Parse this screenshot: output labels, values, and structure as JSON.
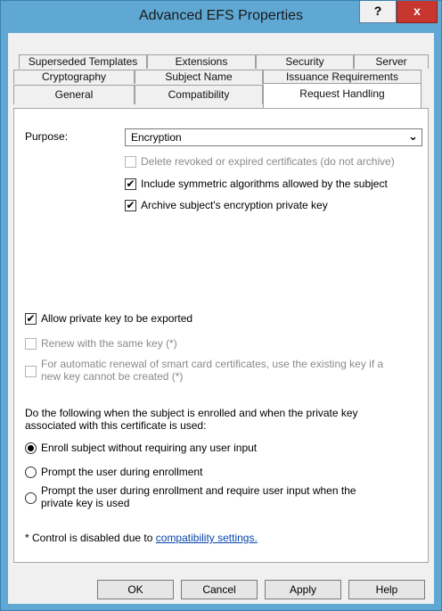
{
  "window": {
    "title": "Advanced EFS Properties",
    "help_glyph": "?",
    "close_glyph": "x"
  },
  "tabs": {
    "row1": [
      "Superseded Templates",
      "Extensions",
      "Security",
      "Server"
    ],
    "row2": [
      "Cryptography",
      "Subject Name",
      "Issuance Requirements"
    ],
    "row3": [
      "General",
      "Compatibility",
      "Request Handling"
    ],
    "active": "Request Handling"
  },
  "purpose": {
    "label": "Purpose:",
    "value": "Encryption",
    "dropdown_glyph": "⌄"
  },
  "options": {
    "delete_revoked": {
      "label": "Delete revoked or expired certificates (do not archive)",
      "checked": false,
      "enabled": false
    },
    "include_symmetric": {
      "label": "Include symmetric algorithms allowed by the subject",
      "checked": true,
      "enabled": true
    },
    "archive_key": {
      "label": "Archive subject's encryption private key",
      "checked": true,
      "enabled": true
    },
    "allow_export": {
      "label": "Allow private key to be exported",
      "checked": true,
      "enabled": true
    },
    "renew_same_key": {
      "label": "Renew with the same key (*)",
      "checked": false,
      "enabled": false
    },
    "smartcard_line1": "For automatic renewal of smart card certificates, use the existing key if a",
    "smartcard_line2": "new key cannot be created (*)"
  },
  "enroll": {
    "intro_line1": "Do the following when the subject is enrolled and when the private key",
    "intro_line2": "associated with this certificate is used:",
    "radios": [
      "Enroll subject without requiring any user input",
      "Prompt the user during enrollment",
      "Prompt the user during enrollment and require user input when the"
    ],
    "radio3_line2": "private key is used",
    "selected": 0
  },
  "footnote": {
    "text": "* Control is disabled due to ",
    "link": "compatibility settings."
  },
  "buttons": {
    "ok": "OK",
    "cancel": "Cancel",
    "apply": "Apply",
    "help": "Help"
  }
}
